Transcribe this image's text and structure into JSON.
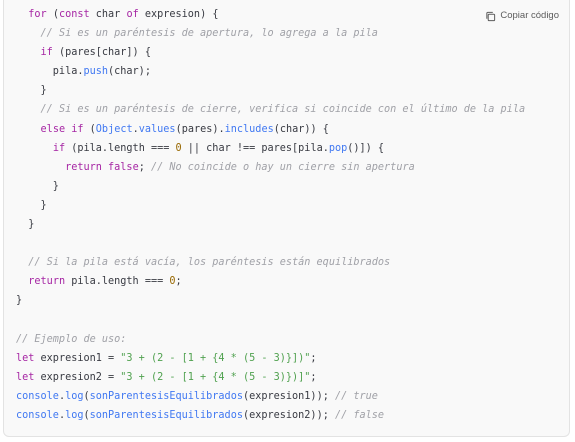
{
  "copy_button": {
    "label": "Copiar código",
    "icon": "copy-icon"
  },
  "colors": {
    "keyword": "#a626a4",
    "function": "#4078f2",
    "string": "#50a14f",
    "number": "#986801",
    "comment": "#a0a1a7",
    "plain": "#383a42"
  },
  "code_lines": [
    [
      [
        "pl",
        "  "
      ],
      [
        "kw",
        "for"
      ],
      [
        "pl",
        " ("
      ],
      [
        "kw",
        "const"
      ],
      [
        "pl",
        " char "
      ],
      [
        "kw",
        "of"
      ],
      [
        "pl",
        " expresion) {"
      ]
    ],
    [
      [
        "pl",
        "    "
      ],
      [
        "cm",
        "// Si es un paréntesis de apertura, lo agrega a la pila"
      ]
    ],
    [
      [
        "pl",
        "    "
      ],
      [
        "kw",
        "if"
      ],
      [
        "pl",
        " (pares[char]) {"
      ]
    ],
    [
      [
        "pl",
        "      pila."
      ],
      [
        "fn",
        "push"
      ],
      [
        "pl",
        "(char);"
      ]
    ],
    [
      [
        "pl",
        "    }"
      ]
    ],
    [
      [
        "pl",
        "    "
      ],
      [
        "cm",
        "// Si es un paréntesis de cierre, verifica si coincide con el último de la pila"
      ]
    ],
    [
      [
        "pl",
        "    "
      ],
      [
        "kw",
        "else"
      ],
      [
        "pl",
        " "
      ],
      [
        "kw",
        "if"
      ],
      [
        "pl",
        " ("
      ],
      [
        "fn",
        "Object"
      ],
      [
        "pl",
        "."
      ],
      [
        "fn",
        "values"
      ],
      [
        "pl",
        "(pares)."
      ],
      [
        "fn",
        "includes"
      ],
      [
        "pl",
        "(char)) {"
      ]
    ],
    [
      [
        "pl",
        "      "
      ],
      [
        "kw",
        "if"
      ],
      [
        "pl",
        " (pila.length === "
      ],
      [
        "num",
        "0"
      ],
      [
        "pl",
        " || char !== pares[pila."
      ],
      [
        "fn",
        "pop"
      ],
      [
        "pl",
        "()]) {"
      ]
    ],
    [
      [
        "pl",
        "        "
      ],
      [
        "kw",
        "return"
      ],
      [
        "pl",
        " "
      ],
      [
        "kw",
        "false"
      ],
      [
        "pl",
        "; "
      ],
      [
        "cm",
        "// No coincide o hay un cierre sin apertura"
      ]
    ],
    [
      [
        "pl",
        "      }"
      ]
    ],
    [
      [
        "pl",
        "    }"
      ]
    ],
    [
      [
        "pl",
        "  }"
      ]
    ],
    [
      [
        "pl",
        ""
      ]
    ],
    [
      [
        "pl",
        "  "
      ],
      [
        "cm",
        "// Si la pila está vacía, los paréntesis están equilibrados"
      ]
    ],
    [
      [
        "pl",
        "  "
      ],
      [
        "kw",
        "return"
      ],
      [
        "pl",
        " pila.length === "
      ],
      [
        "num",
        "0"
      ],
      [
        "pl",
        ";"
      ]
    ],
    [
      [
        "pl",
        "}"
      ]
    ],
    [
      [
        "pl",
        ""
      ]
    ],
    [
      [
        "cm",
        "// Ejemplo de uso:"
      ]
    ],
    [
      [
        "kw",
        "let"
      ],
      [
        "pl",
        " expresion1 = "
      ],
      [
        "str",
        "\"3 + (2 - [1 + {4 * (5 - 3)}])\""
      ],
      [
        "pl",
        ";"
      ]
    ],
    [
      [
        "kw",
        "let"
      ],
      [
        "pl",
        " expresion2 = "
      ],
      [
        "str",
        "\"3 + (2 - [1 + {4 * (5 - 3)})]\""
      ],
      [
        "pl",
        ";"
      ]
    ],
    [
      [
        "fn",
        "console"
      ],
      [
        "pl",
        "."
      ],
      [
        "fn",
        "log"
      ],
      [
        "pl",
        "("
      ],
      [
        "fn",
        "sonParentesisEquilibrados"
      ],
      [
        "pl",
        "(expresion1)); "
      ],
      [
        "cm",
        "// true"
      ]
    ],
    [
      [
        "fn",
        "console"
      ],
      [
        "pl",
        "."
      ],
      [
        "fn",
        "log"
      ],
      [
        "pl",
        "("
      ],
      [
        "fn",
        "sonParentesisEquilibrados"
      ],
      [
        "pl",
        "(expresion2)); "
      ],
      [
        "cm",
        "// false"
      ]
    ]
  ]
}
